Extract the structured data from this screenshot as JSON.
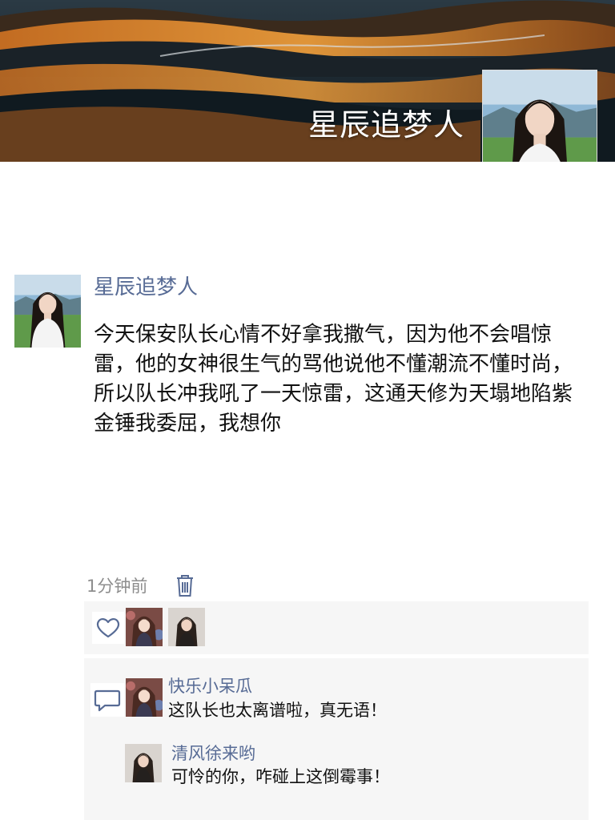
{
  "profile": {
    "display_name": "星辰追梦人"
  },
  "post": {
    "author": "星辰追梦人",
    "text": "今天保安队长心情不好拿我撒气，因为他不会唱惊雷，他的女神很生气的骂他说他不懂潮流不懂时尚，所以队长冲我吼了一天惊雷，这通天修为天塌地陷紫金锤我委屈，我想你",
    "time": "1分钟前"
  },
  "likes": {
    "icon": "heart-icon"
  },
  "comments": [
    {
      "author": "快乐小呆瓜",
      "text": "这队长也太离谱啦，真无语！"
    },
    {
      "author": "清风徐来哟",
      "text": "可怜的你，咋碰上这倒霉事！"
    }
  ],
  "colors": {
    "link": "#576b95",
    "time": "#8d8d8d",
    "panel": "#f6f6f6",
    "trash": "#576b95"
  }
}
